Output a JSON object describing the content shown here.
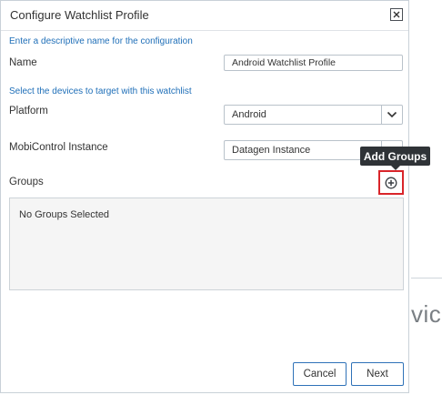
{
  "background": {
    "partial_text": "vic"
  },
  "dialog": {
    "title": "Configure Watchlist Profile",
    "close_icon": "close-x-icon",
    "name_hint": "Enter a descriptive name for the configuration",
    "name_label": "Name",
    "name_value": "Android Watchlist Profile",
    "devices_hint": "Select the devices to target with this watchlist",
    "platform_label": "Platform",
    "platform_value": "Android",
    "instance_label": "MobiControl Instance",
    "instance_value": "Datagen Instance",
    "groups_label": "Groups",
    "add_groups_tooltip": "Add Groups",
    "add_groups_icon": "plus-circle-icon",
    "groups_empty_text": "No Groups Selected",
    "cancel_label": "Cancel",
    "next_label": "Next"
  },
  "colors": {
    "hint_blue": "#1f6fb8",
    "highlight_red": "#d9252a",
    "button_border": "#2f72b8",
    "tooltip_bg": "#2f3337"
  }
}
